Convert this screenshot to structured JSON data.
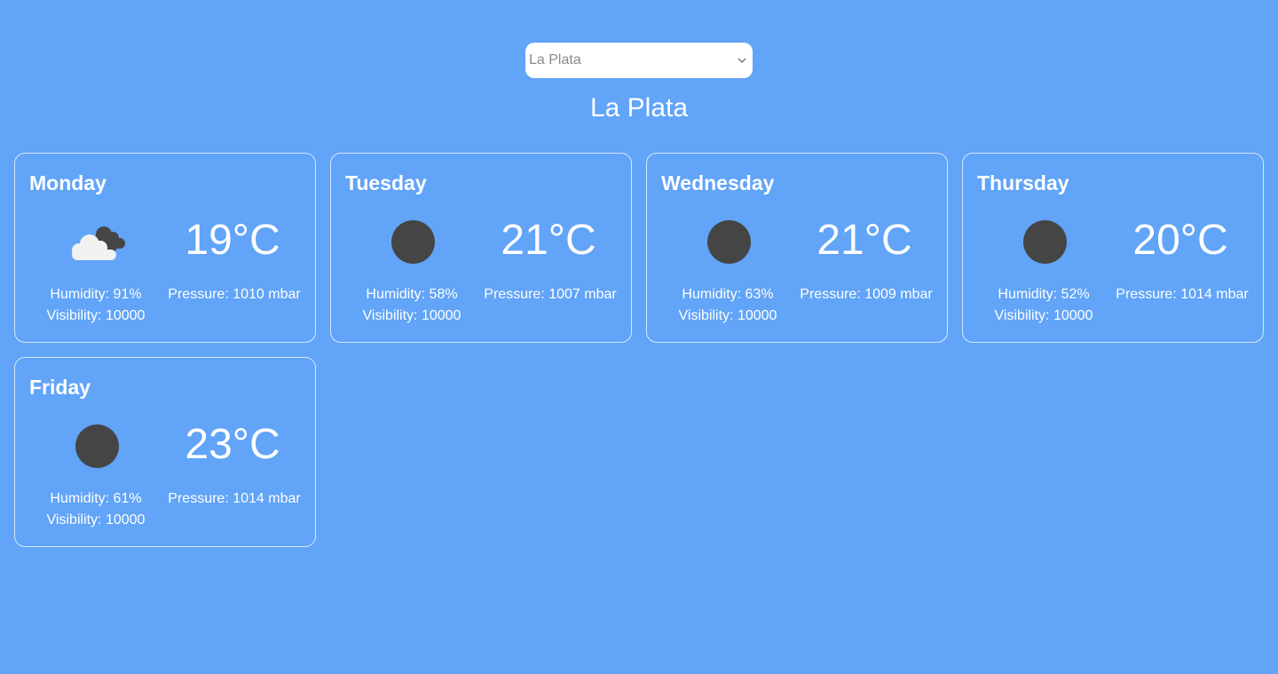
{
  "city_select": {
    "value": "La Plata",
    "options": [
      "La Plata"
    ]
  },
  "city_title": "La Plata",
  "forecast": [
    {
      "day": "Monday",
      "icon": "cloudy-icon",
      "temperature": "19°C",
      "humidity": "Humidity: 91%",
      "visibility": "Visibility: 10000",
      "pressure": "Pressure: 1010 mbar"
    },
    {
      "day": "Tuesday",
      "icon": "dark-circle-icon",
      "temperature": "21°C",
      "humidity": "Humidity: 58%",
      "visibility": "Visibility: 10000",
      "pressure": "Pressure: 1007 mbar"
    },
    {
      "day": "Wednesday",
      "icon": "dark-circle-icon",
      "temperature": "21°C",
      "humidity": "Humidity: 63%",
      "visibility": "Visibility: 10000",
      "pressure": "Pressure: 1009 mbar"
    },
    {
      "day": "Thursday",
      "icon": "dark-circle-icon",
      "temperature": "20°C",
      "humidity": "Humidity: 52%",
      "visibility": "Visibility: 10000",
      "pressure": "Pressure: 1014 mbar"
    },
    {
      "day": "Friday",
      "icon": "dark-circle-icon",
      "temperature": "23°C",
      "humidity": "Humidity: 61%",
      "visibility": "Visibility: 10000",
      "pressure": "Pressure: 1014 mbar"
    }
  ],
  "colors": {
    "background": "#61a4f8",
    "card_border": "#d6e7fd",
    "icon_dark": "#454545",
    "text": "#ffffff"
  }
}
